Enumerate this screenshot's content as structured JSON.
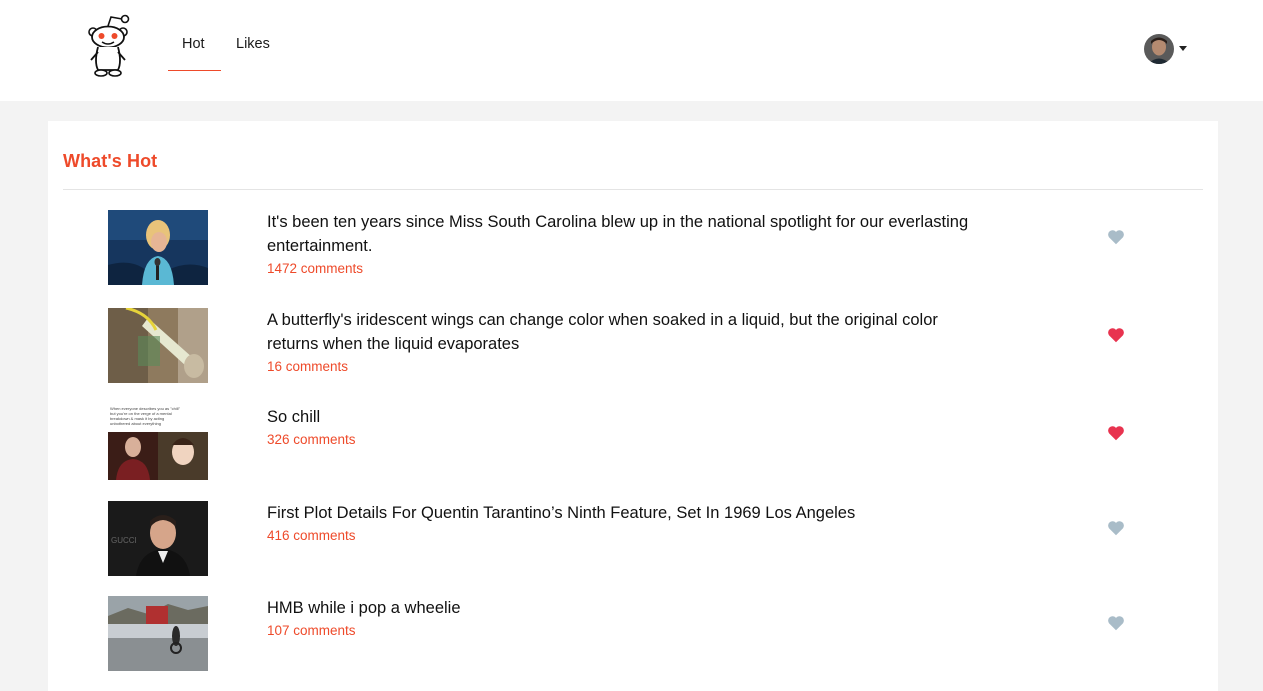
{
  "nav": {
    "tabs": [
      {
        "label": "Hot",
        "active": true
      },
      {
        "label": "Likes",
        "active": false
      }
    ],
    "accent_color": "#ee4a2a"
  },
  "user": {
    "avatar_icon": "user-avatar",
    "menu_icon": "caret-down-icon"
  },
  "main": {
    "section_title": "What's Hot",
    "posts": [
      {
        "title": "It's been ten years since Miss South Carolina blew up in the national spotlight for our everlasting entertainment.",
        "comments": "1472 comments",
        "liked": false
      },
      {
        "title": "A butterfly's iridescent wings can change color when soaked in a liquid, but the original color returns when the liquid evaporates",
        "comments": "16 comments",
        "liked": true
      },
      {
        "title": "So chill",
        "comments": "326 comments",
        "liked": true,
        "thumb_text": "When everyone describes you as \"chill\" but you're on the verge of a mental breakdown & mask it by acting unbothered about everything"
      },
      {
        "title": "First Plot Details For Quentin Tarantino’s Ninth Feature, Set In 1969 Los Angeles",
        "comments": "416 comments",
        "liked": false,
        "thumb_text": "GUCCI LACMA FILM"
      },
      {
        "title": "HMB while i pop a wheelie",
        "comments": "107 comments",
        "liked": false
      }
    ]
  },
  "colors": {
    "heart_liked": "#e8334f",
    "heart_unliked": "#a9bcc8",
    "comments": "#ee4a2a"
  }
}
